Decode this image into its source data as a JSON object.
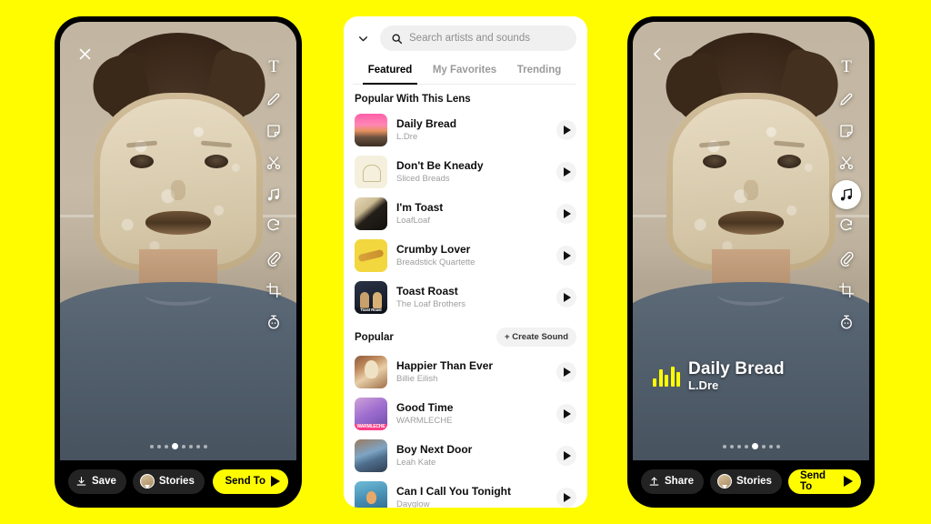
{
  "theme": {
    "background": "#FFFC00",
    "accent": "#FFFC00",
    "frame": "#000000",
    "panel_bg": "#FFFFFF"
  },
  "left_phone": {
    "close_icon": "close-icon",
    "tools": [
      {
        "name": "text-tool",
        "glyph": "T",
        "active": false
      },
      {
        "name": "draw-tool",
        "glyph": "pencil-icon",
        "active": false
      },
      {
        "name": "sticker-tool",
        "glyph": "sticker-icon",
        "active": false
      },
      {
        "name": "scissors-tool",
        "glyph": "scissors-icon",
        "active": false
      },
      {
        "name": "music-tool",
        "glyph": "music-note-icon",
        "active": false
      },
      {
        "name": "magic-tool",
        "glyph": "magic-wand-icon",
        "active": false
      },
      {
        "name": "attach-tool",
        "glyph": "paperclip-icon",
        "active": false
      },
      {
        "name": "crop-tool",
        "glyph": "crop-icon",
        "active": false
      },
      {
        "name": "timer-tool",
        "glyph": "timer-icon",
        "active": false
      }
    ],
    "dots": {
      "count": 8,
      "active_index": 3
    },
    "actions": {
      "save_label": "Save",
      "stories_label": "Stories",
      "send_label": "Send To"
    }
  },
  "right_phone": {
    "back_icon": "back-chevron-icon",
    "tools": [
      {
        "name": "text-tool",
        "glyph": "T",
        "active": false
      },
      {
        "name": "draw-tool",
        "glyph": "pencil-icon",
        "active": false
      },
      {
        "name": "sticker-tool",
        "glyph": "sticker-icon",
        "active": false
      },
      {
        "name": "scissors-tool",
        "glyph": "scissors-icon",
        "active": false
      },
      {
        "name": "music-tool",
        "glyph": "music-note-icon",
        "active": true
      },
      {
        "name": "magic-tool",
        "glyph": "magic-wand-icon",
        "active": false
      },
      {
        "name": "attach-tool",
        "glyph": "paperclip-icon",
        "active": false
      },
      {
        "name": "crop-tool",
        "glyph": "crop-icon",
        "active": false
      },
      {
        "name": "timer-tool",
        "glyph": "timer-icon",
        "active": false
      }
    ],
    "music_sticker": {
      "title": "Daily Bread",
      "artist": "L.Dre"
    },
    "dots": {
      "count": 8,
      "active_index": 4
    },
    "actions": {
      "share_label": "Share",
      "stories_label": "Stories",
      "send_label": "Send To"
    }
  },
  "sounds_panel": {
    "search": {
      "placeholder": "Search artists and sounds",
      "icon": "search-icon"
    },
    "collapse_icon": "chevron-down-icon",
    "tabs": [
      {
        "label": "Featured",
        "active": true
      },
      {
        "label": "My Favorites",
        "active": false
      },
      {
        "label": "Trending",
        "active": false
      }
    ],
    "sections": [
      {
        "title": "Popular With This Lens",
        "create_button": null,
        "tracks": [
          {
            "title": "Daily Bread",
            "artist": "L.Dre",
            "art": "a-daily",
            "art_label": ""
          },
          {
            "title": "Don't Be Kneady",
            "artist": "Sliced Breads",
            "art": "a-kneady",
            "art_label": ""
          },
          {
            "title": "I'm Toast",
            "artist": "LoafLoaf",
            "art": "a-toast",
            "art_label": ""
          },
          {
            "title": "Crumby Lover",
            "artist": "Breadstick Quartette",
            "art": "a-crumby",
            "art_label": ""
          },
          {
            "title": "Toast Roast",
            "artist": "The Loaf Brothers",
            "art": "a-roast",
            "art_label": "Toast Roast"
          }
        ]
      },
      {
        "title": "Popular",
        "create_button": "+ Create Sound",
        "tracks": [
          {
            "title": "Happier Than Ever",
            "artist": "Billie Eilish",
            "art": "a-happier",
            "art_label": ""
          },
          {
            "title": "Good Time",
            "artist": "WARMLECHE",
            "art": "a-goodtime",
            "art_label": "WARMLECHE"
          },
          {
            "title": "Boy Next Door",
            "artist": "Leah Kate",
            "art": "a-boynext",
            "art_label": ""
          },
          {
            "title": "Can I Call You Tonight",
            "artist": "Dayglow",
            "art": "a-cancall",
            "art_label": ""
          }
        ]
      }
    ]
  }
}
